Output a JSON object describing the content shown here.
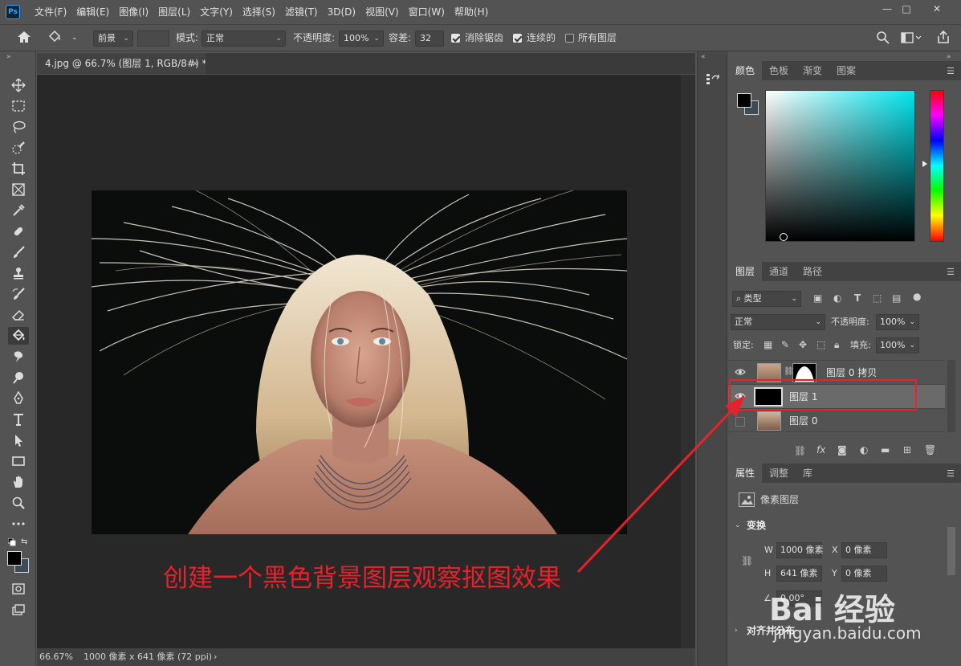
{
  "app": {
    "logo": "Ps"
  },
  "menu": [
    "文件(F)",
    "编辑(E)",
    "图像(I)",
    "图层(L)",
    "文字(Y)",
    "选择(S)",
    "滤镜(T)",
    "3D(D)",
    "视图(V)",
    "窗口(W)",
    "帮助(H)"
  ],
  "window_controls": {
    "minimize": "—",
    "restore": "□",
    "close": "✕"
  },
  "options": {
    "fill_source": "前景",
    "mode_label": "模式:",
    "mode_value": "正常",
    "opacity_label": "不透明度:",
    "opacity_value": "100%",
    "tolerance_label": "容差:",
    "tolerance_value": "32",
    "antialias_label": "消除锯齿",
    "contiguous_label": "连续的",
    "all_layers_label": "所有图层",
    "antialias_checked": true,
    "contiguous_checked": true,
    "all_layers_checked": false
  },
  "document": {
    "tab_title": "4.jpg @ 66.7% (图层 1, RGB/8#) *",
    "tab_close": "×",
    "zoom": "66.67%",
    "doc_info": "1000 像素 x 641 像素 (72 ppi)",
    "status_arrow": "›"
  },
  "color_panel": {
    "tabs": [
      "颜色",
      "色板",
      "渐变",
      "图案"
    ],
    "foreground": "#000000",
    "background": "#3b4c57",
    "hue_color": "#00e5ee"
  },
  "layers_panel": {
    "tabs": [
      "图层",
      "通道",
      "路径"
    ],
    "filter_label": "类型",
    "blend_mode": "正常",
    "opacity_label": "不透明度:",
    "opacity_value": "100%",
    "lock_label": "锁定:",
    "fill_label": "填充:",
    "fill_value": "100%",
    "layers": [
      {
        "name": "图层 0 拷贝",
        "visible": true,
        "selected": false
      },
      {
        "name": "图层 1",
        "visible": true,
        "selected": true
      },
      {
        "name": "图层 0",
        "visible": false,
        "selected": false
      }
    ]
  },
  "properties_panel": {
    "tabs": [
      "属性",
      "调整",
      "库"
    ],
    "layer_type": "像素图层",
    "transform_label": "变换",
    "w_label": "W",
    "w_value": "1000 像素",
    "h_label": "H",
    "h_value": "641 像素",
    "x_label": "X",
    "x_value": "0 像素",
    "y_label": "Y",
    "y_value": "0 像素",
    "angle_value": "0.00°",
    "align_label": "对齐并分布"
  },
  "annotation": {
    "text": "创建一个黑色背景图层观察抠图效果",
    "color": "#e8222b"
  },
  "watermark": {
    "cn": "Bai 经验",
    "en": "jingyan.baidu.com"
  }
}
